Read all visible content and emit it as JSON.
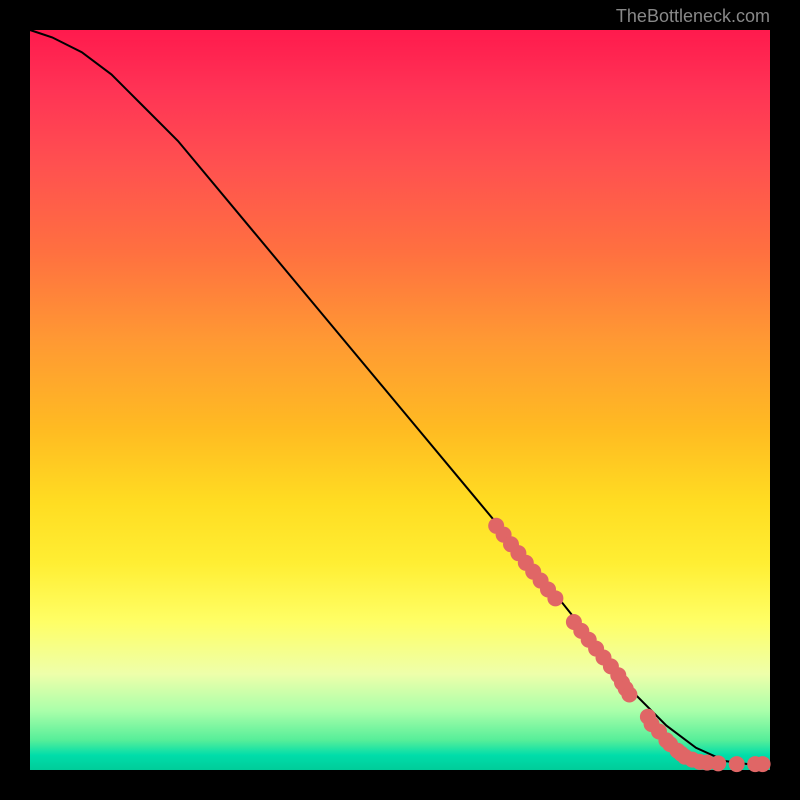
{
  "attribution": "TheBottleneck.com",
  "chart_data": {
    "type": "line",
    "title": "",
    "xlabel": "",
    "ylabel": "",
    "xlim": [
      0,
      100
    ],
    "ylim": [
      0,
      100
    ],
    "curve": {
      "x": [
        0,
        3,
        7,
        11,
        15,
        20,
        30,
        40,
        50,
        60,
        70,
        74,
        78,
        82,
        86,
        90,
        94,
        97,
        100
      ],
      "y": [
        100,
        99,
        97,
        94,
        90,
        85,
        73,
        61,
        49,
        37,
        25,
        20,
        15,
        10,
        6,
        3,
        1.2,
        0.8,
        0.8
      ]
    },
    "points": [
      {
        "x": 63.0,
        "y": 33.0
      },
      {
        "x": 64.0,
        "y": 31.8
      },
      {
        "x": 65.0,
        "y": 30.5
      },
      {
        "x": 66.0,
        "y": 29.3
      },
      {
        "x": 67.0,
        "y": 28.0
      },
      {
        "x": 68.0,
        "y": 26.8
      },
      {
        "x": 69.0,
        "y": 25.6
      },
      {
        "x": 70.0,
        "y": 24.4
      },
      {
        "x": 71.0,
        "y": 23.2
      },
      {
        "x": 73.5,
        "y": 20.0
      },
      {
        "x": 74.5,
        "y": 18.8
      },
      {
        "x": 75.5,
        "y": 17.6
      },
      {
        "x": 76.5,
        "y": 16.4
      },
      {
        "x": 77.5,
        "y": 15.2
      },
      {
        "x": 78.5,
        "y": 14.0
      },
      {
        "x": 79.5,
        "y": 12.8
      },
      {
        "x": 80.0,
        "y": 11.8
      },
      {
        "x": 80.5,
        "y": 11.0
      },
      {
        "x": 81.0,
        "y": 10.2
      },
      {
        "x": 83.5,
        "y": 7.2
      },
      {
        "x": 84.0,
        "y": 6.2
      },
      {
        "x": 85.0,
        "y": 5.2
      },
      {
        "x": 86.0,
        "y": 4.0
      },
      {
        "x": 86.5,
        "y": 3.5
      },
      {
        "x": 87.5,
        "y": 2.6
      },
      {
        "x": 88.0,
        "y": 2.2
      },
      {
        "x": 88.5,
        "y": 1.8
      },
      {
        "x": 89.5,
        "y": 1.4
      },
      {
        "x": 90.5,
        "y": 1.1
      },
      {
        "x": 91.5,
        "y": 1.0
      },
      {
        "x": 93.0,
        "y": 0.9
      },
      {
        "x": 95.5,
        "y": 0.8
      },
      {
        "x": 98.0,
        "y": 0.8
      },
      {
        "x": 99.0,
        "y": 0.8
      }
    ],
    "point_color": "#e06666",
    "line_color": "#000000"
  }
}
